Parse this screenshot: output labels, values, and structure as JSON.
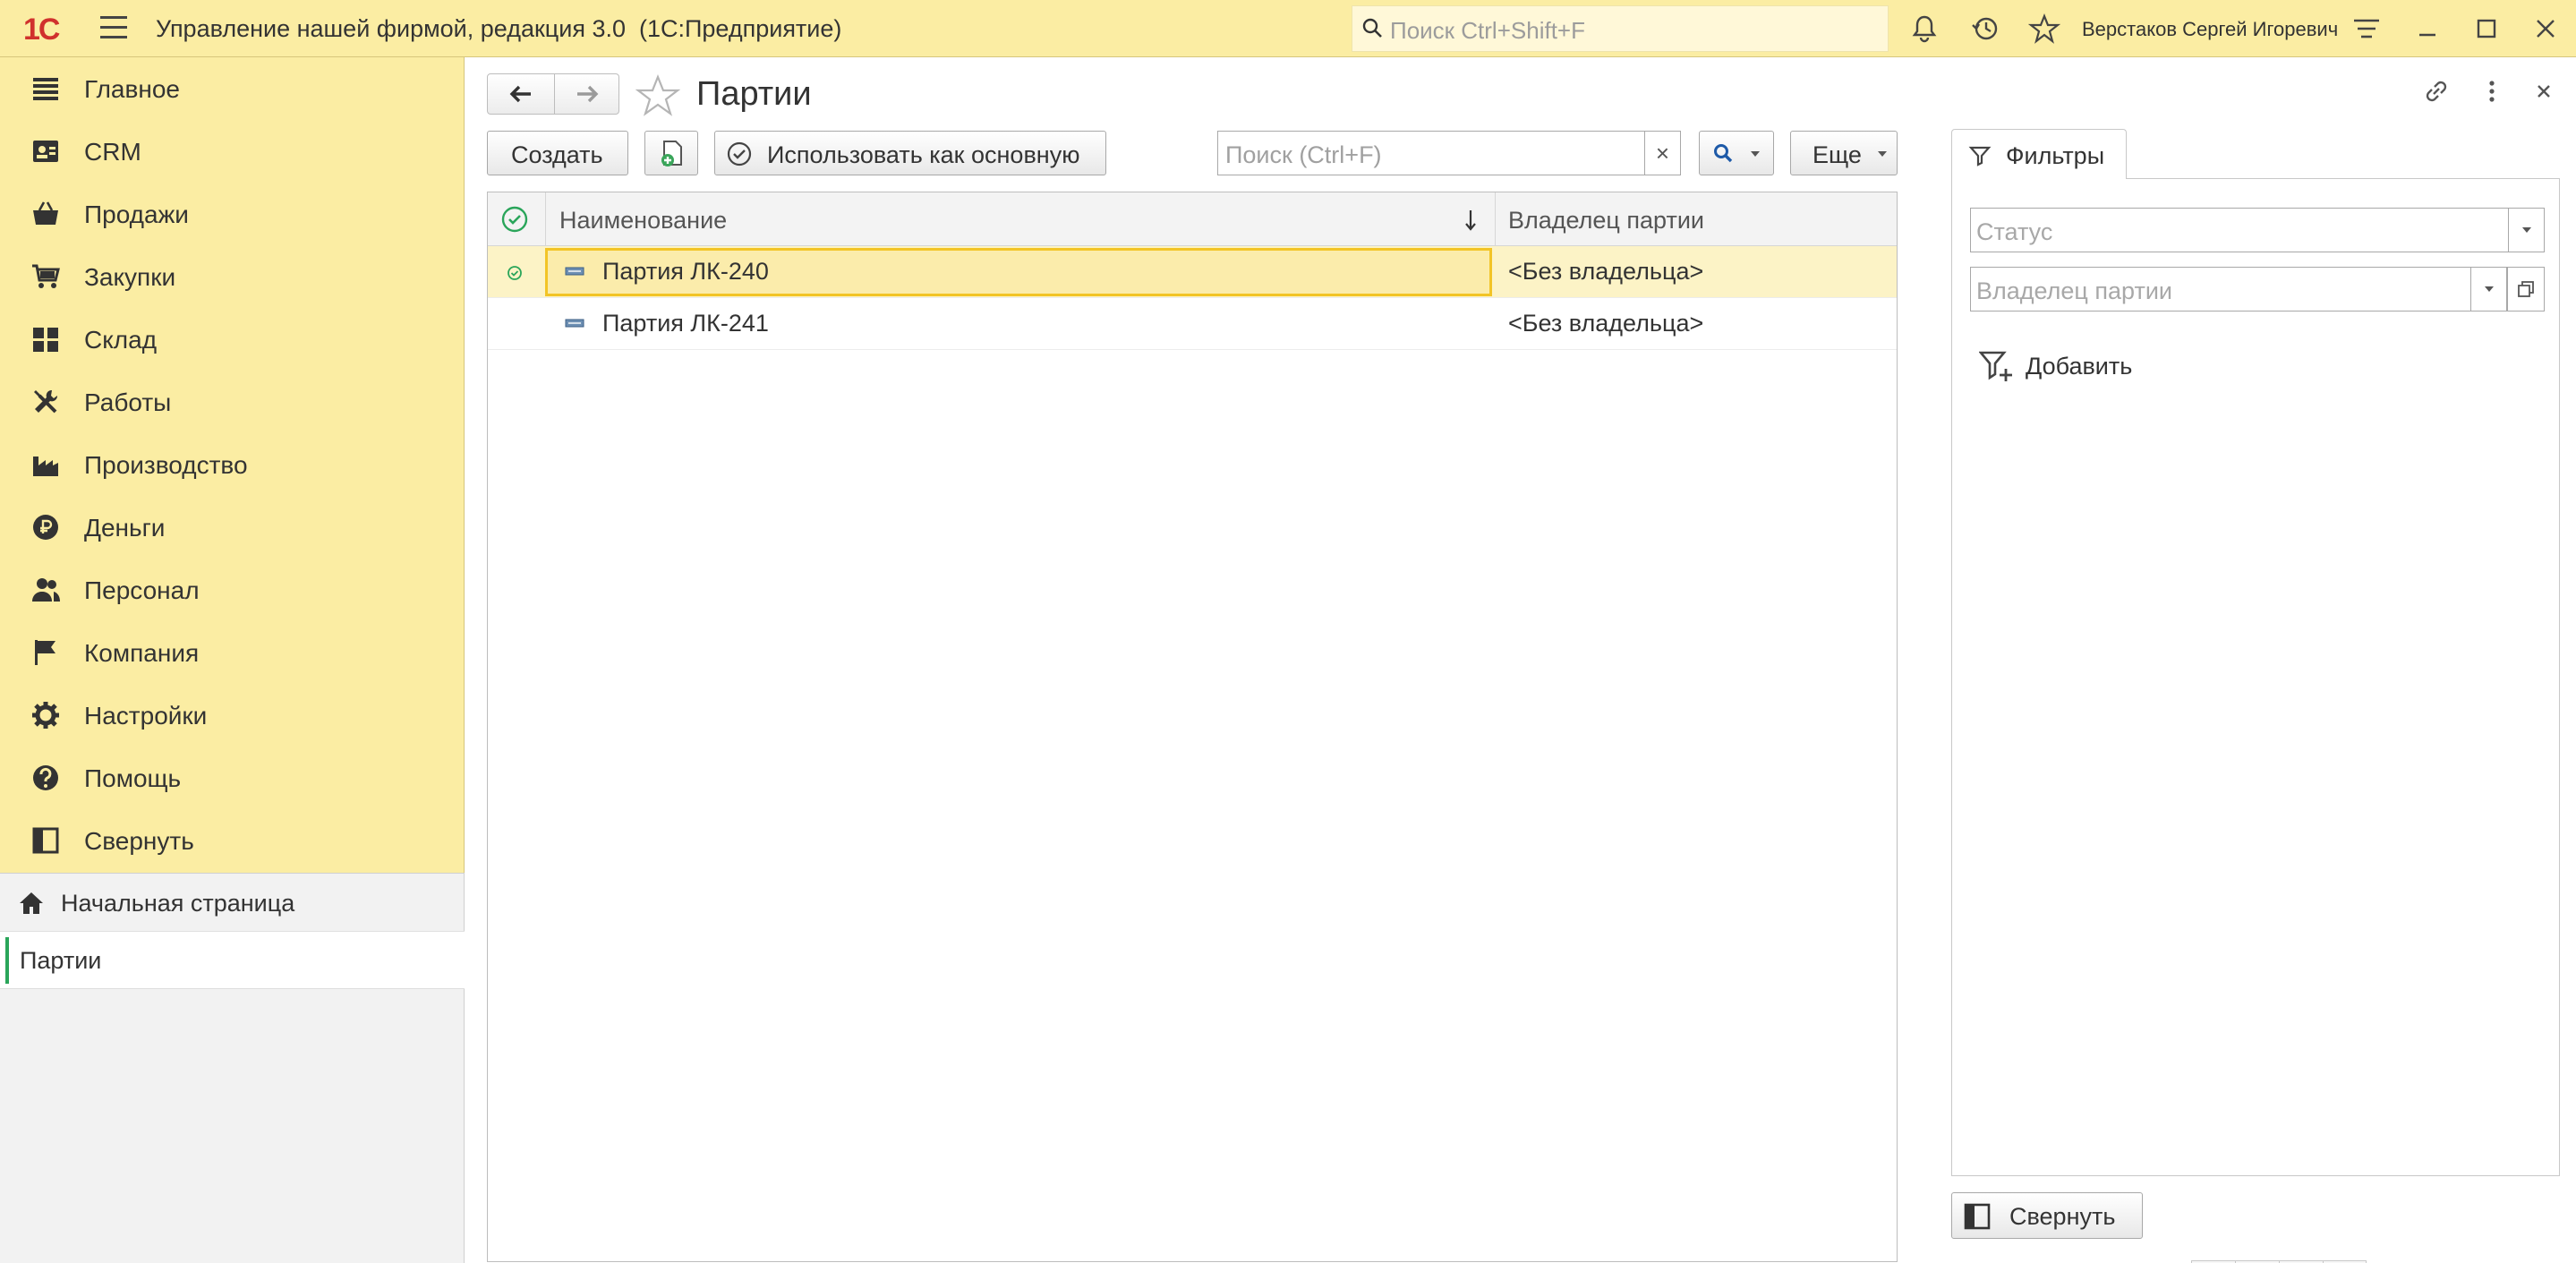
{
  "titlebar": {
    "logo": "1С",
    "title": "Управление нашей фирмой, редакция 3.0  (1С:Предприятие)",
    "search_placeholder": "Поиск Ctrl+Shift+F",
    "user": "Верстаков Сергей Игоревич"
  },
  "sidebar": {
    "items": [
      {
        "label": "Главное",
        "icon": "list-icon"
      },
      {
        "label": "CRM",
        "icon": "contacts-icon"
      },
      {
        "label": "Продажи",
        "icon": "basket-icon"
      },
      {
        "label": "Закупки",
        "icon": "cart-icon"
      },
      {
        "label": "Склад",
        "icon": "warehouse-icon"
      },
      {
        "label": "Работы",
        "icon": "tools-icon"
      },
      {
        "label": "Производство",
        "icon": "factory-icon"
      },
      {
        "label": "Деньги",
        "icon": "ruble-icon"
      },
      {
        "label": "Персонал",
        "icon": "people-icon"
      },
      {
        "label": "Компания",
        "icon": "flag-icon"
      },
      {
        "label": "Настройки",
        "icon": "gear-icon"
      },
      {
        "label": "Помощь",
        "icon": "help-icon"
      },
      {
        "label": "Свернуть",
        "icon": "collapse-panel-icon"
      }
    ]
  },
  "opened": {
    "home": "Начальная страница",
    "active": "Партии"
  },
  "page": {
    "title": "Партии",
    "create_label": "Создать",
    "use_default_label": "Использовать как основную",
    "search_placeholder": "Поиск (Ctrl+F)",
    "clear_label": "×",
    "more_label": "Еще"
  },
  "table": {
    "columns": {
      "name": "Наименование",
      "owner": "Владелец партии"
    },
    "rows": [
      {
        "name": "Партия ЛК-240",
        "owner": "<Без владельца>",
        "selected": true,
        "default": true
      },
      {
        "name": "Партия ЛК-241",
        "owner": "<Без владельца>",
        "selected": false,
        "default": false
      }
    ]
  },
  "filters": {
    "tab_label": "Фильтры",
    "status_placeholder": "Статус",
    "owner_placeholder": "Владелец партии",
    "add_label": "Добавить",
    "collapse_label": "Свернуть"
  },
  "colors": {
    "accent_yellow": "#fbeda3",
    "selection_border": "#f2c426",
    "active_green": "#2aa55a",
    "logo_red": "#d0312d"
  }
}
